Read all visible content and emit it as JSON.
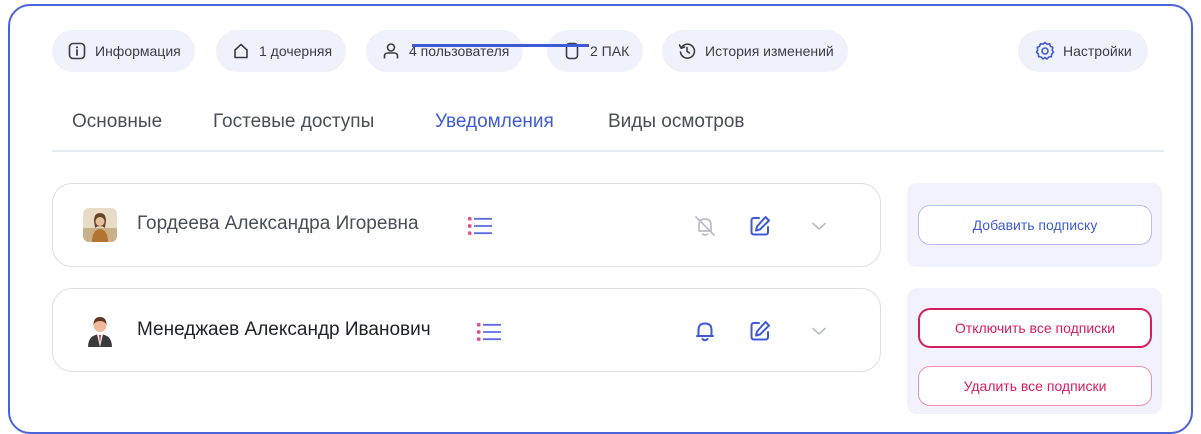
{
  "top_chips": {
    "info": {
      "label": "Информация",
      "icon": "info-icon"
    },
    "children": {
      "label": "1 дочерняя",
      "icon": "home-icon"
    },
    "users": {
      "label": "4 пользователя",
      "icon": "user-icon"
    },
    "pak": {
      "label": "2 ПАК",
      "icon": "device-icon"
    },
    "history": {
      "label": "История изменений",
      "icon": "history-icon"
    },
    "settings": {
      "label": "Настройки",
      "icon": "gear-icon"
    }
  },
  "tabs": [
    {
      "label": "Основные",
      "active": false
    },
    {
      "label": "Гостевые доступы",
      "active": false
    },
    {
      "label": "Уведомления",
      "active": true
    },
    {
      "label": "Виды осмотров",
      "active": false
    }
  ],
  "subscribers": [
    {
      "name": "Гордеева Александра Игоревна",
      "notifications": "off",
      "avatar": "avatar-woman"
    },
    {
      "name": "Менеджаев Александр Иванович",
      "notifications": "on",
      "avatar": "avatar-man"
    }
  ],
  "side_actions": {
    "add_subscription": "Добавить подписку",
    "disable_all": "Отключить все подписки",
    "delete_all": "Удалить все подписки"
  },
  "colors": {
    "accent": "#3f5ad4",
    "danger": "#d81b60",
    "danger_light": "#ef8fb2",
    "list_icon_a": "#e6489a",
    "list_icon_b": "#5a6be0"
  }
}
